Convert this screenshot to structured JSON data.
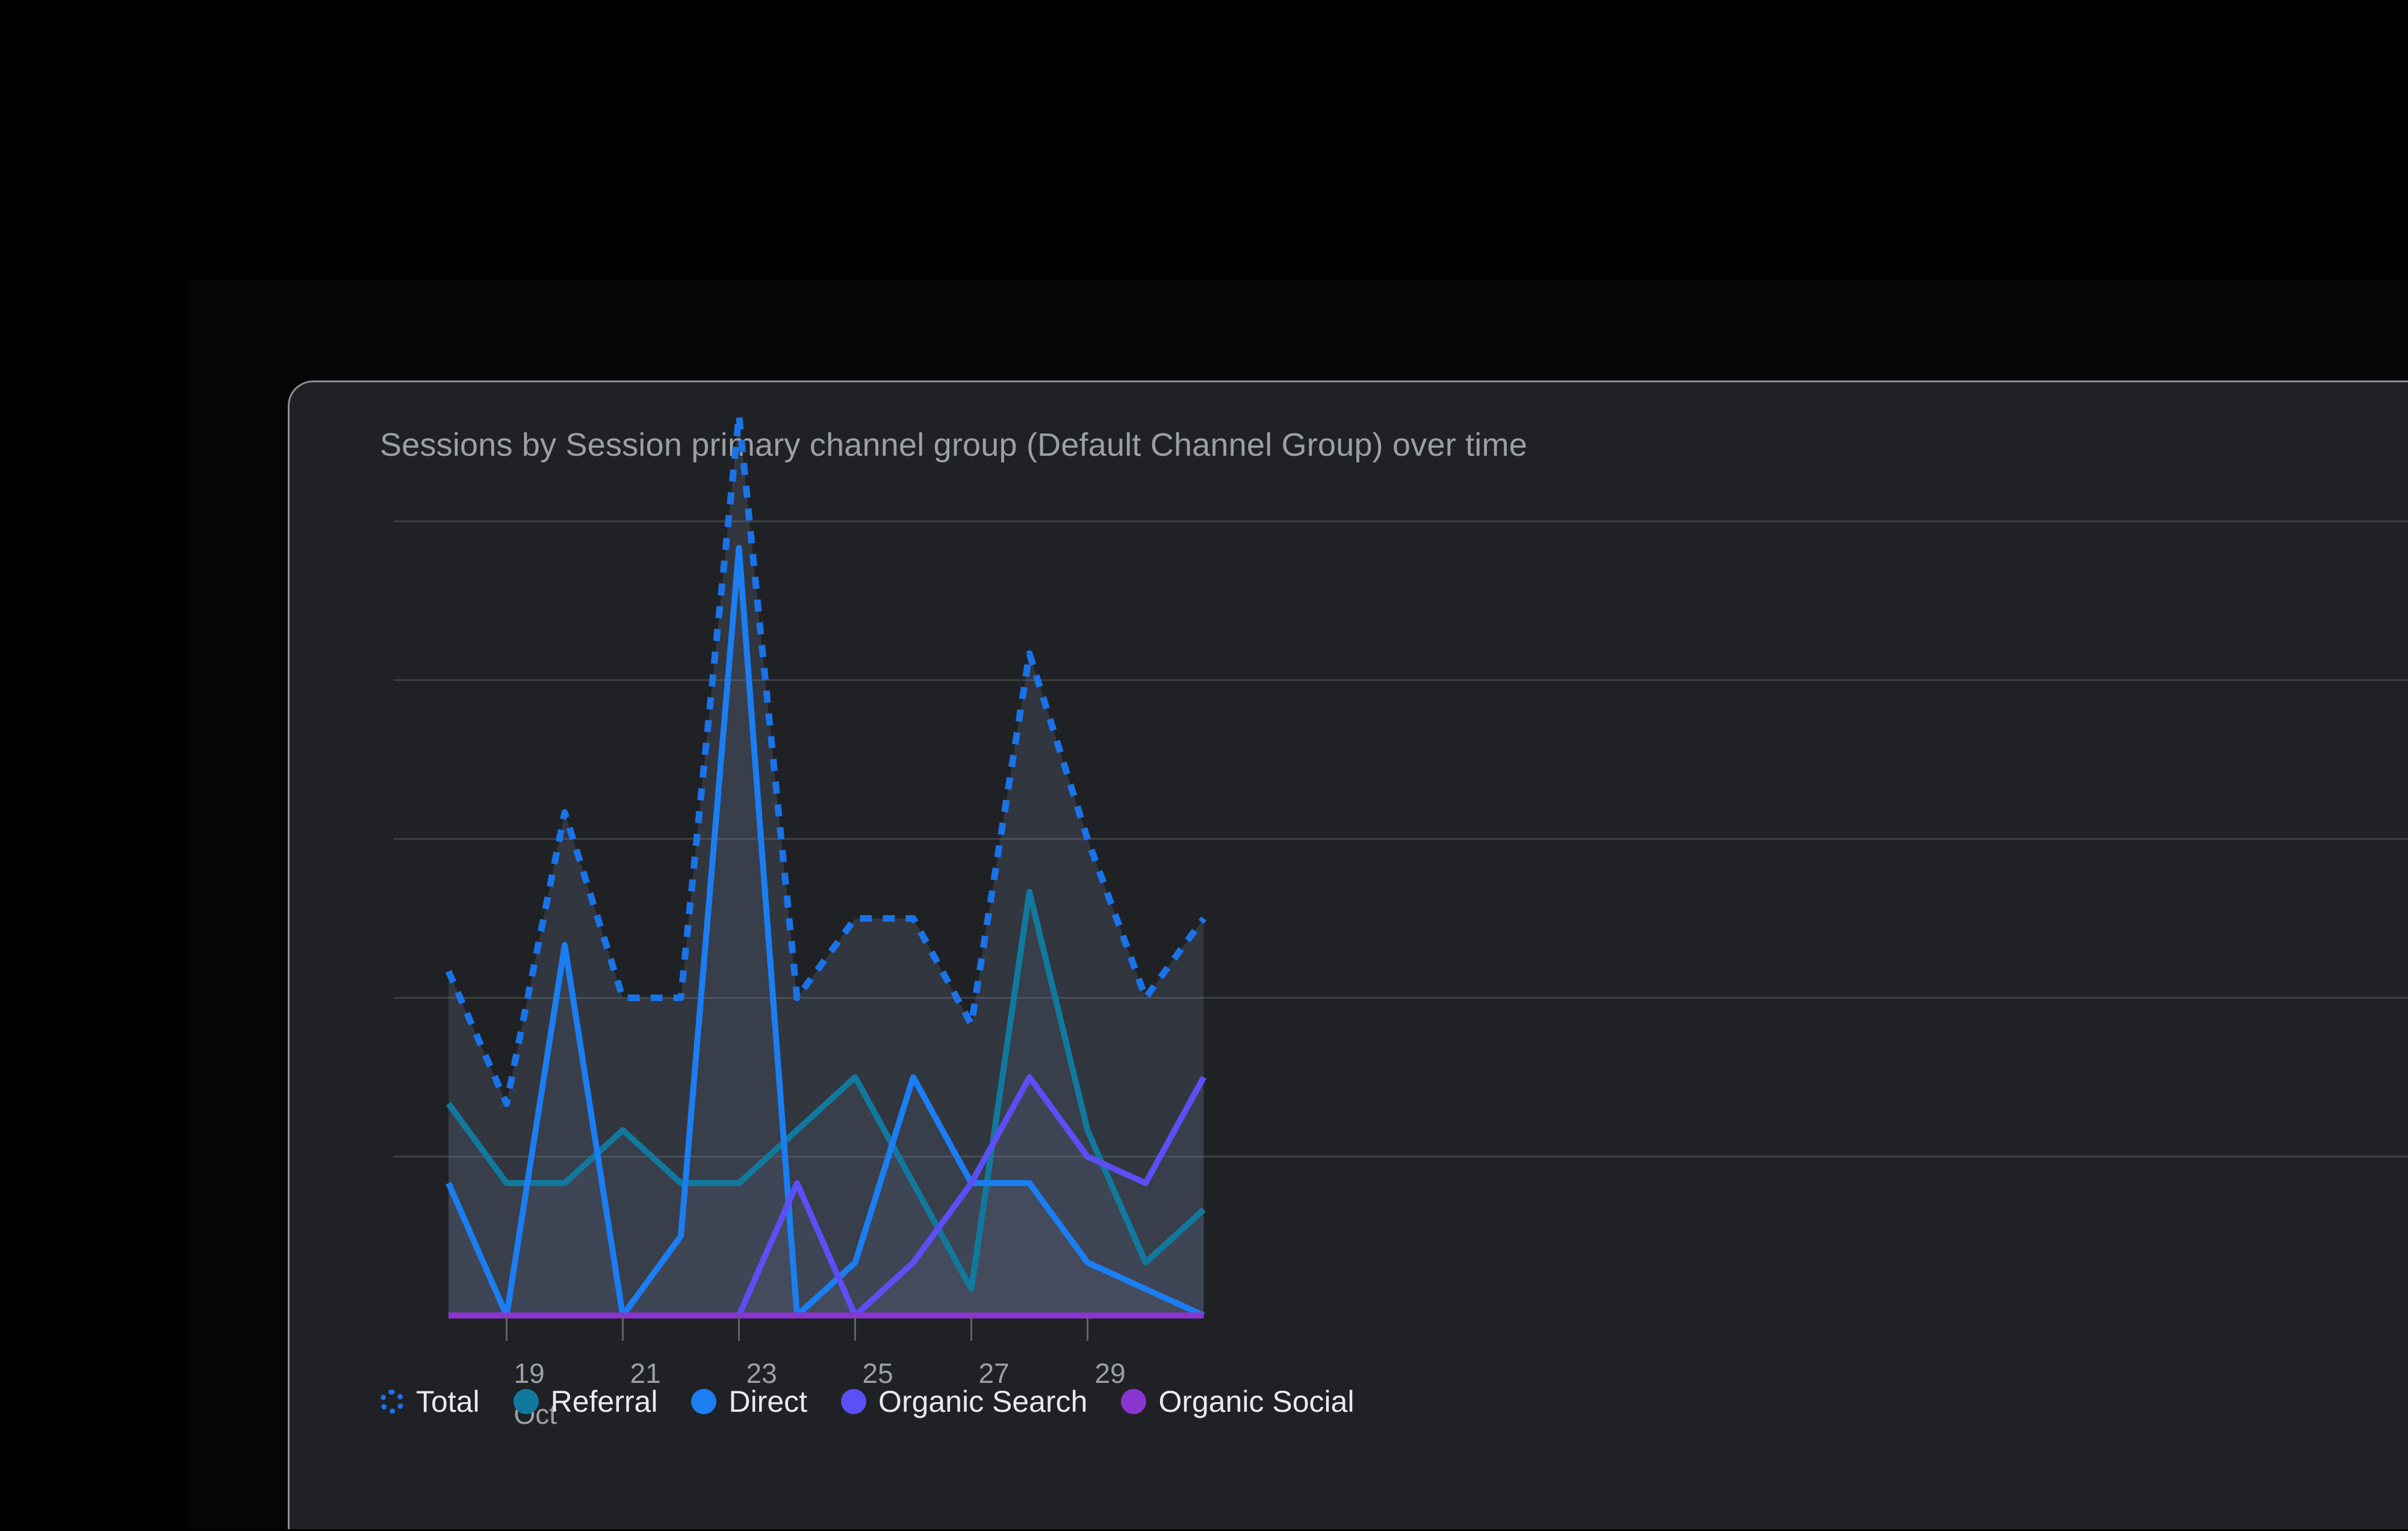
{
  "card": {
    "title": "Sessions by Session primary channel group (Default Channel Group) over time"
  },
  "legend": {
    "items": [
      {
        "label": "Total",
        "color": "#1a73e8",
        "style": "dotted"
      },
      {
        "label": "Referral",
        "color": "#12799e",
        "style": "solid"
      },
      {
        "label": "Direct",
        "color": "#1b7ef2",
        "style": "solid"
      },
      {
        "label": "Organic Search",
        "color": "#5b4ff5",
        "style": "solid"
      },
      {
        "label": "Organic Social",
        "color": "#8a35d0",
        "style": "solid"
      }
    ]
  },
  "axis": {
    "x_tick_labels": [
      "19",
      "21",
      "23",
      "25",
      "27",
      "29"
    ],
    "x_month_label": "Oct"
  },
  "chart_data": {
    "type": "area",
    "title": "Sessions by Session primary channel group (Default Channel Group) over time",
    "xlabel": "",
    "ylabel": "",
    "grid": true,
    "legend_position": "bottom-left",
    "x": [
      "18",
      "19",
      "20",
      "21",
      "22",
      "23",
      "24",
      "25",
      "26",
      "27",
      "28",
      "29",
      "30",
      "31"
    ],
    "x_tick_labels": [
      "19",
      "21",
      "23",
      "25",
      "27",
      "29"
    ],
    "x_month_label": "Oct",
    "ylim": [
      0,
      34
    ],
    "y_gridlines": [
      6,
      12,
      18,
      24,
      30,
      36
    ],
    "series": [
      {
        "name": "Total",
        "color": "#1a73e8",
        "style": "dotted",
        "values": [
          13,
          8,
          19,
          12,
          12,
          34,
          12,
          15,
          15,
          11,
          25,
          18,
          12,
          15
        ]
      },
      {
        "name": "Referral",
        "color": "#12799e",
        "style": "solid",
        "values": [
          8,
          5,
          5,
          7,
          5,
          5,
          7,
          9,
          5,
          1,
          16,
          7,
          2,
          4
        ]
      },
      {
        "name": "Direct",
        "color": "#1b7ef2",
        "style": "solid",
        "values": [
          5,
          0,
          14,
          0,
          3,
          29,
          0,
          2,
          9,
          5,
          5,
          2,
          1,
          0
        ]
      },
      {
        "name": "Organic Search",
        "color": "#5b4ff5",
        "style": "solid",
        "values": [
          0,
          0,
          0,
          0,
          0,
          0,
          5,
          0,
          2,
          5,
          9,
          6,
          5,
          9
        ]
      },
      {
        "name": "Organic Social",
        "color": "#8a35d0",
        "style": "solid",
        "values": [
          0,
          0,
          0,
          0,
          0,
          0,
          0,
          0,
          0,
          0,
          0,
          0,
          0,
          0
        ]
      }
    ]
  }
}
